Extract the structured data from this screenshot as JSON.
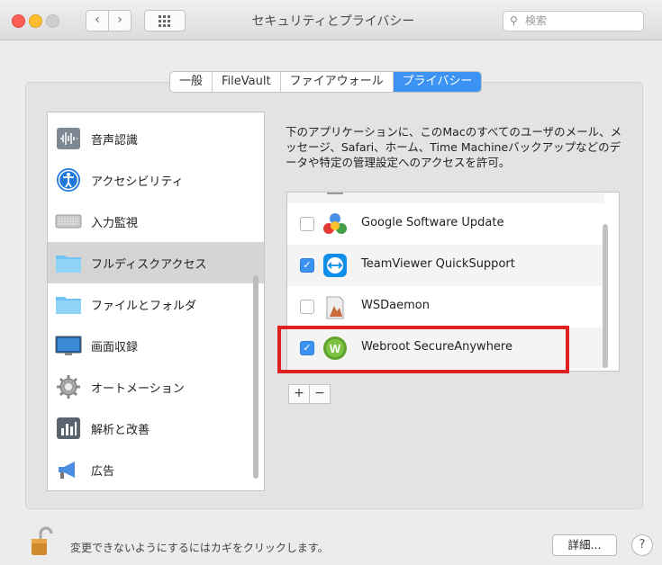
{
  "window": {
    "title": "セキュリティとプライバシー",
    "search_placeholder": "検索",
    "back_icon": "‹",
    "forward_icon": "›"
  },
  "tabs": [
    {
      "label": "一般"
    },
    {
      "label": "FileVault"
    },
    {
      "label": "ファイアウォール"
    },
    {
      "label": "プライバシー",
      "active": true
    }
  ],
  "sidebar": {
    "items": [
      {
        "label": "音声認識",
        "icon": "speech-recognition-icon"
      },
      {
        "label": "アクセシビリティ",
        "icon": "accessibility-icon"
      },
      {
        "label": "入力監視",
        "icon": "keyboard-icon"
      },
      {
        "label": "フルディスクアクセス",
        "icon": "folder-icon",
        "selected": true
      },
      {
        "label": "ファイルとフォルダ",
        "icon": "folder-icon"
      },
      {
        "label": "画面収録",
        "icon": "display-icon"
      },
      {
        "label": "オートメーション",
        "icon": "gear-icon"
      },
      {
        "label": "解析と改善",
        "icon": "analytics-icon"
      },
      {
        "label": "広告",
        "icon": "megaphone-icon"
      }
    ]
  },
  "description": "下のアプリケーションに、このMacのすべてのユーザのメール、メッセージ、Safari、ホーム、Time Machineバックアップなどのデータや特定の管理設定へのアクセスを許可。",
  "apps": [
    {
      "name": "Google Software Update",
      "checked": false,
      "icon": "google-software-update-icon"
    },
    {
      "name": "TeamViewer QuickSupport",
      "checked": true,
      "icon": "teamviewer-icon"
    },
    {
      "name": "WSDaemon",
      "checked": false,
      "icon": "wsdaemon-icon"
    },
    {
      "name": "Webroot SecureAnywhere",
      "checked": true,
      "icon": "webroot-icon"
    }
  ],
  "list_controls": {
    "add": "+",
    "remove": "−"
  },
  "footer": {
    "lock_text": "変更できないようにするにはカギをクリックします。",
    "advanced_label": "詳細...",
    "help_label": "?"
  },
  "colors": {
    "accent": "#3c93f3",
    "highlight": "#e02121"
  }
}
